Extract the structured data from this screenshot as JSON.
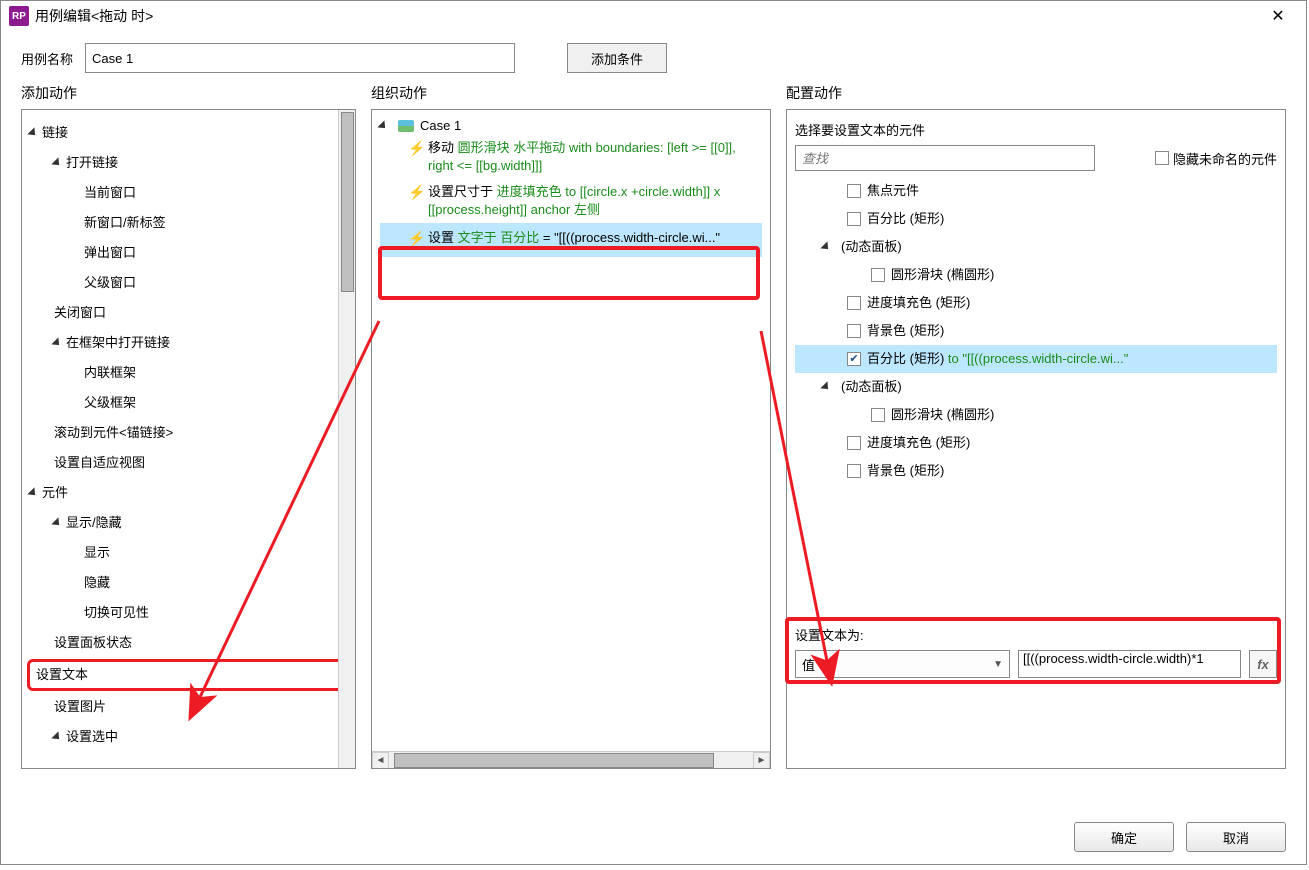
{
  "title": "用例编辑<拖动 时>",
  "caseNameLabel": "用例名称",
  "caseNameValue": "Case 1",
  "addConditionLabel": "添加条件",
  "columns": {
    "add": "添加动作",
    "org": "组织动作",
    "cfg": "配置动作"
  },
  "addTree": {
    "links": "链接",
    "openLink": "打开链接",
    "currentWindow": "当前窗口",
    "newWindow": "新窗口/新标签",
    "popup": "弹出窗口",
    "parentWindow": "父级窗口",
    "closeWindow": "关闭窗口",
    "openInFrame": "在框架中打开链接",
    "inlineFrame": "内联框架",
    "parentFrame": "父级框架",
    "scrollToAnchor": "滚动到元件<锚链接>",
    "adaptiveView": "设置自适应视图",
    "widgets": "元件",
    "showHide": "显示/隐藏",
    "show": "显示",
    "hide": "隐藏",
    "toggleVis": "切换可见性",
    "panelState": "设置面板状态",
    "setText": "设置文本",
    "setImage": "设置图片",
    "setSelected": "设置选中"
  },
  "orgCase": "Case 1",
  "orgActions": {
    "a1_pre": "移动 ",
    "a1_g": "圆形滑块 水平拖动 with boundaries: [left >= [[0]], right <= [[bg.width]]]",
    "a2_pre": "设置尺寸于 ",
    "a2_g": "进度填充色 to [[circle.x +circle.width]] x [[process.height]] anchor 左侧",
    "a3_pre": "设置 ",
    "a3_mid": "文字于 百分比",
    "a3_post": " = \"[[((process.width-circle.wi...\""
  },
  "cfg": {
    "selectTarget": "选择要设置文本的元件",
    "searchPlaceholder": "查找",
    "hideUnnamed": "隐藏未命名的元件",
    "focus": "焦点元件",
    "percent": "百分比 (矩形)",
    "dynPanel1": "(动态面板)",
    "circSlider1": "圆形滑块 (椭圆形)",
    "fill1": "进度填充色 (矩形)",
    "bg1": "背景色 (矩形)",
    "percentSel_pre": "百分比 (矩形) ",
    "percentSel_g": "to \"[[((process.width-circle.wi...\"",
    "dynPanel2": "(动态面板)",
    "circSlider2": "圆形滑块 (椭圆形)",
    "fill2": "进度填充色 (矩形)",
    "bg2": "背景色 (矩形)",
    "setTextTo": "设置文本为:",
    "valueLabel": "值",
    "exprValue": "[[((process.width-circle.width)*1",
    "ok": "确定",
    "cancel": "取消"
  }
}
